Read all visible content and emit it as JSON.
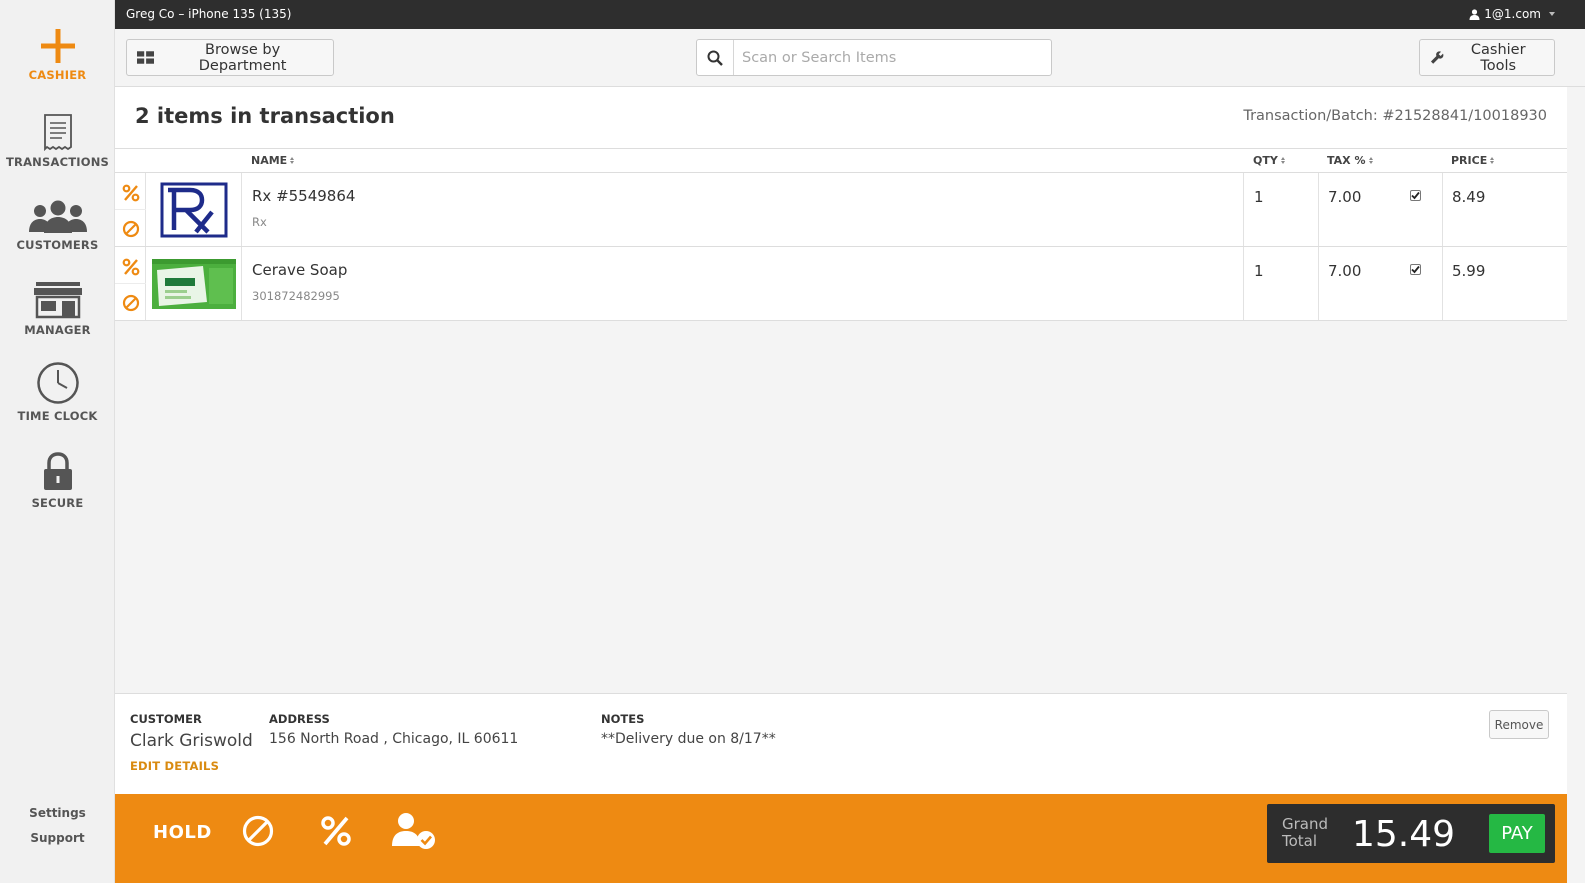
{
  "sidebar": {
    "items": [
      {
        "label": "CASHIER",
        "icon": "plus-icon",
        "active": true
      },
      {
        "label": "TRANSACTIONS",
        "icon": "receipt-icon"
      },
      {
        "label": "CUSTOMERS",
        "icon": "users-icon"
      },
      {
        "label": "MANAGER",
        "icon": "store-icon"
      },
      {
        "label": "TIME CLOCK",
        "icon": "clock-icon"
      },
      {
        "label": "SECURE",
        "icon": "lock-icon"
      }
    ],
    "settings_label": "Settings",
    "support_label": "Support"
  },
  "topbar": {
    "device": "Greg Co – iPhone 135 (135)",
    "user": "1@1.com"
  },
  "toolbar": {
    "browse_label": "Browse by Department",
    "search_placeholder": "Scan or Search Items",
    "tools_label": "Cashier Tools"
  },
  "transaction": {
    "count_label": "2 items in transaction",
    "batch_label": "Transaction/Batch: #21528841/10018930"
  },
  "table": {
    "headers": {
      "name": "NAME",
      "qty": "QTY",
      "tax": "TAX %",
      "price": "PRICE"
    },
    "rows": [
      {
        "name": "Rx #5549864",
        "sku": "Rx",
        "qty": "1",
        "tax": "7.00",
        "taxable": true,
        "price": "8.49"
      },
      {
        "name": "Cerave Soap",
        "sku": "301872482995",
        "qty": "1",
        "tax": "7.00",
        "taxable": true,
        "price": "5.99"
      }
    ]
  },
  "customer": {
    "customer_label": "CUSTOMER",
    "name": "Clark Griswold",
    "edit_label": "EDIT DETAILS",
    "address_label": "ADDRESS",
    "address": "156 North Road , Chicago, IL 60611",
    "notes_label": "NOTES",
    "notes": "**Delivery due on 8/17**",
    "remove_label": "Remove"
  },
  "footer": {
    "hold_label": "HOLD",
    "grand_total_label": "Grand Total",
    "grand_total": "15.49",
    "pay_label": "PAY"
  },
  "colors": {
    "accent": "#ee8a12",
    "topbar": "#2e2e2e",
    "pay_green": "#25b844",
    "total_box": "#2d2d2d"
  }
}
